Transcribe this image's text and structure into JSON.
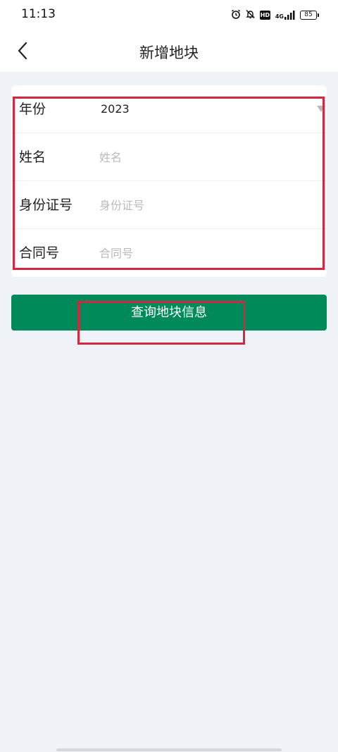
{
  "status_bar": {
    "time": "11:13",
    "network_label": "4G",
    "hd_label": "HD",
    "battery_level": "85",
    "icons": [
      "alarm-icon",
      "mute-bell-icon",
      "hd-icon",
      "signal-icon",
      "battery-icon"
    ]
  },
  "nav": {
    "back_icon": "chevron-left-icon",
    "title": "新增地块"
  },
  "form": {
    "rows": [
      {
        "label": "年份",
        "value": "2023",
        "type": "select"
      },
      {
        "label": "姓名",
        "value": "",
        "placeholder": "姓名",
        "type": "input"
      },
      {
        "label": "身份证号",
        "value": "",
        "placeholder": "身份证号",
        "type": "input"
      },
      {
        "label": "合同号",
        "value": "",
        "placeholder": "合同号",
        "type": "input"
      }
    ]
  },
  "actions": {
    "query_label": "查询地块信息"
  },
  "colors": {
    "primary": "#008a5a",
    "highlight": "#d2283f",
    "background": "#eff3f7",
    "placeholder": "#bbbbbb"
  }
}
